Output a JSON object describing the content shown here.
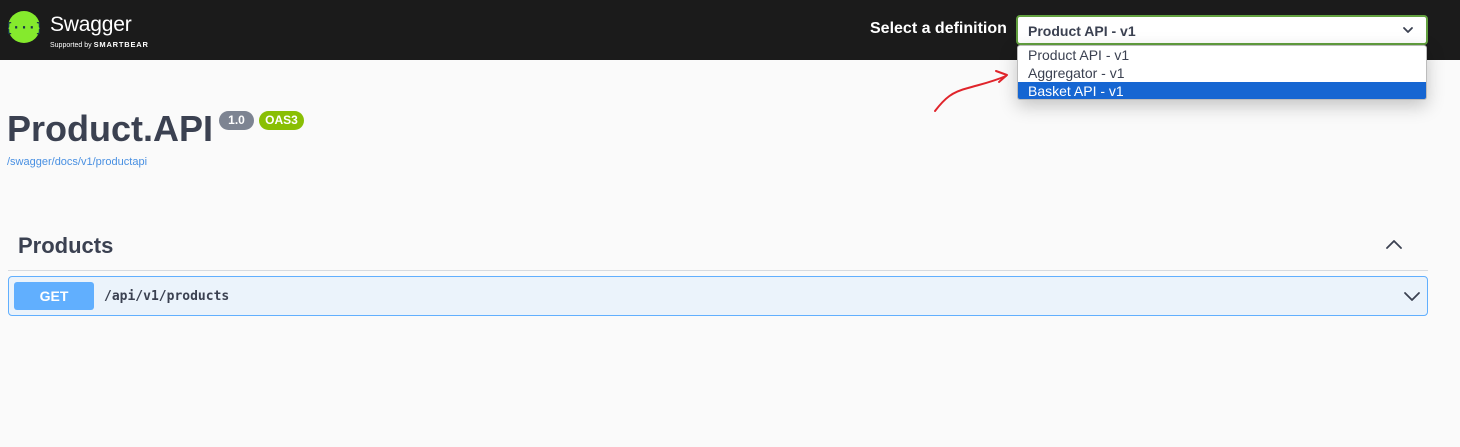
{
  "topbar": {
    "brand": "Swagger",
    "brand_sub_prefix": "Supported by",
    "brand_sub_name": "SMARTBEAR",
    "definition_label": "Select a definition",
    "definition_selected": "Product API - v1",
    "definition_options": [
      {
        "label": "Product API - v1"
      },
      {
        "label": "Aggregator - v1"
      },
      {
        "label": "Basket API - v1"
      }
    ],
    "highlighted_option": "Basket API - v1"
  },
  "info": {
    "title": "Product.API",
    "version_badge": "1.0",
    "oas_badge": "OAS3",
    "spec_url": "/swagger/docs/v1/productapi"
  },
  "tags": [
    {
      "name": "Products",
      "operations": [
        {
          "method": "GET",
          "path": "/api/v1/products"
        }
      ]
    }
  ],
  "colors": {
    "topbar_bg": "#1b1b1b",
    "logo_green": "#85ea2d",
    "select_border": "#62a03f",
    "highlight_blue": "#1666d2",
    "get_blue": "#61affe",
    "op_bg": "#ebf3fb",
    "badge_version": "#7d8492",
    "badge_oas": "#89bf04",
    "link_blue": "#4990e2",
    "annotation_arrow": "#e0242b"
  },
  "icons": {
    "logo": "swagger-logo-icon",
    "select_chevron": "chevron-down-icon",
    "tag_toggle": "chevron-up-icon",
    "op_toggle": "chevron-down-icon",
    "annotation": "red-arrow-annotation"
  }
}
